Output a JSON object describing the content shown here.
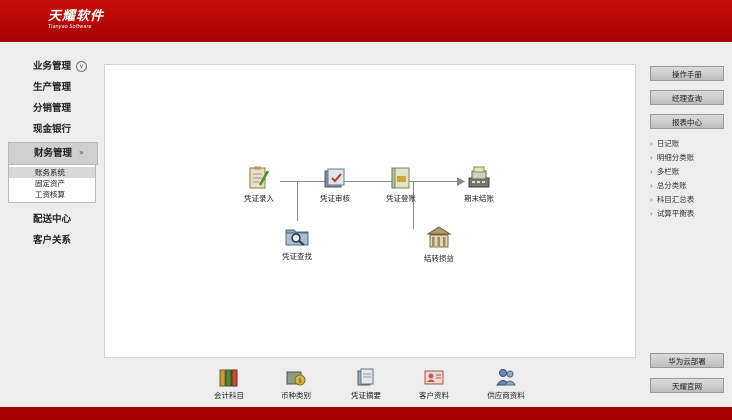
{
  "header": {
    "logo_cn": "天耀软件",
    "logo_en": "Tianyao Software"
  },
  "nav": {
    "items": [
      {
        "label": "业务管理"
      },
      {
        "label": "生产管理"
      },
      {
        "label": "分销管理"
      },
      {
        "label": "现金银行"
      },
      {
        "label": "财务管理"
      },
      {
        "label": "配送中心"
      },
      {
        "label": "客户关系"
      }
    ],
    "finance_sub": [
      "账务系统",
      "固定资产",
      "工资核算"
    ]
  },
  "flow": {
    "voucher_entry": "凭证录入",
    "voucher_review": "凭证审核",
    "voucher_posting": "凭证登账",
    "period_close": "期末结账",
    "voucher_query": "凭证查找",
    "transfer_profit": "结转损益"
  },
  "right": {
    "manual": "操作手册",
    "manager_query": "经理查询",
    "report_center": "报表中心",
    "reports": [
      "日记账",
      "明细分类账",
      "多栏账",
      "总分类账",
      "科目汇总表",
      "试算平衡表"
    ],
    "huawei": "华为云部署",
    "official": "天耀官网"
  },
  "bottom": {
    "accounts": "会计科目",
    "currency": "币种类别",
    "summary": "凭证摘要",
    "customers": "客户资料",
    "suppliers": "供应商资料"
  }
}
